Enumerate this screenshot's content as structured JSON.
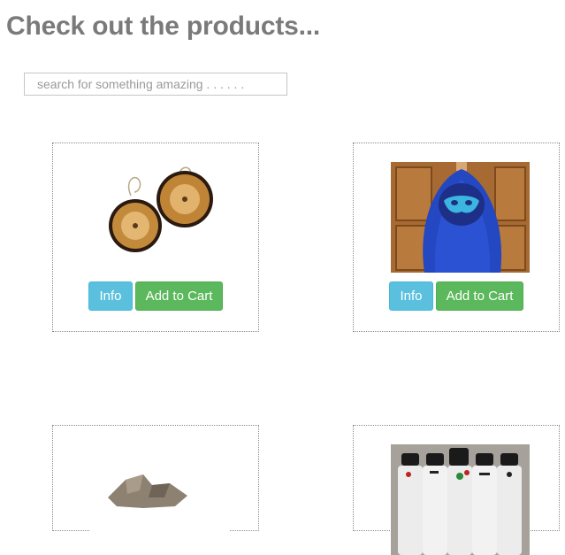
{
  "page": {
    "title": "Check out the products..."
  },
  "search": {
    "placeholder": "search for something amazing . . . . . ."
  },
  "products": [
    {
      "image": "wooden-slice-earrings-image",
      "info_label": "Info",
      "cart_label": "Add to Cart"
    },
    {
      "image": "blue-cape-with-mask-image",
      "info_label": "Info",
      "cart_label": "Add to Cart"
    },
    {
      "image": "stone-sculpture-image"
    },
    {
      "image": "decorated-bottles-image"
    }
  ],
  "colors": {
    "title": "#7a7a7a",
    "info_button": "#5bc0de",
    "cart_button": "#5cb85c"
  }
}
